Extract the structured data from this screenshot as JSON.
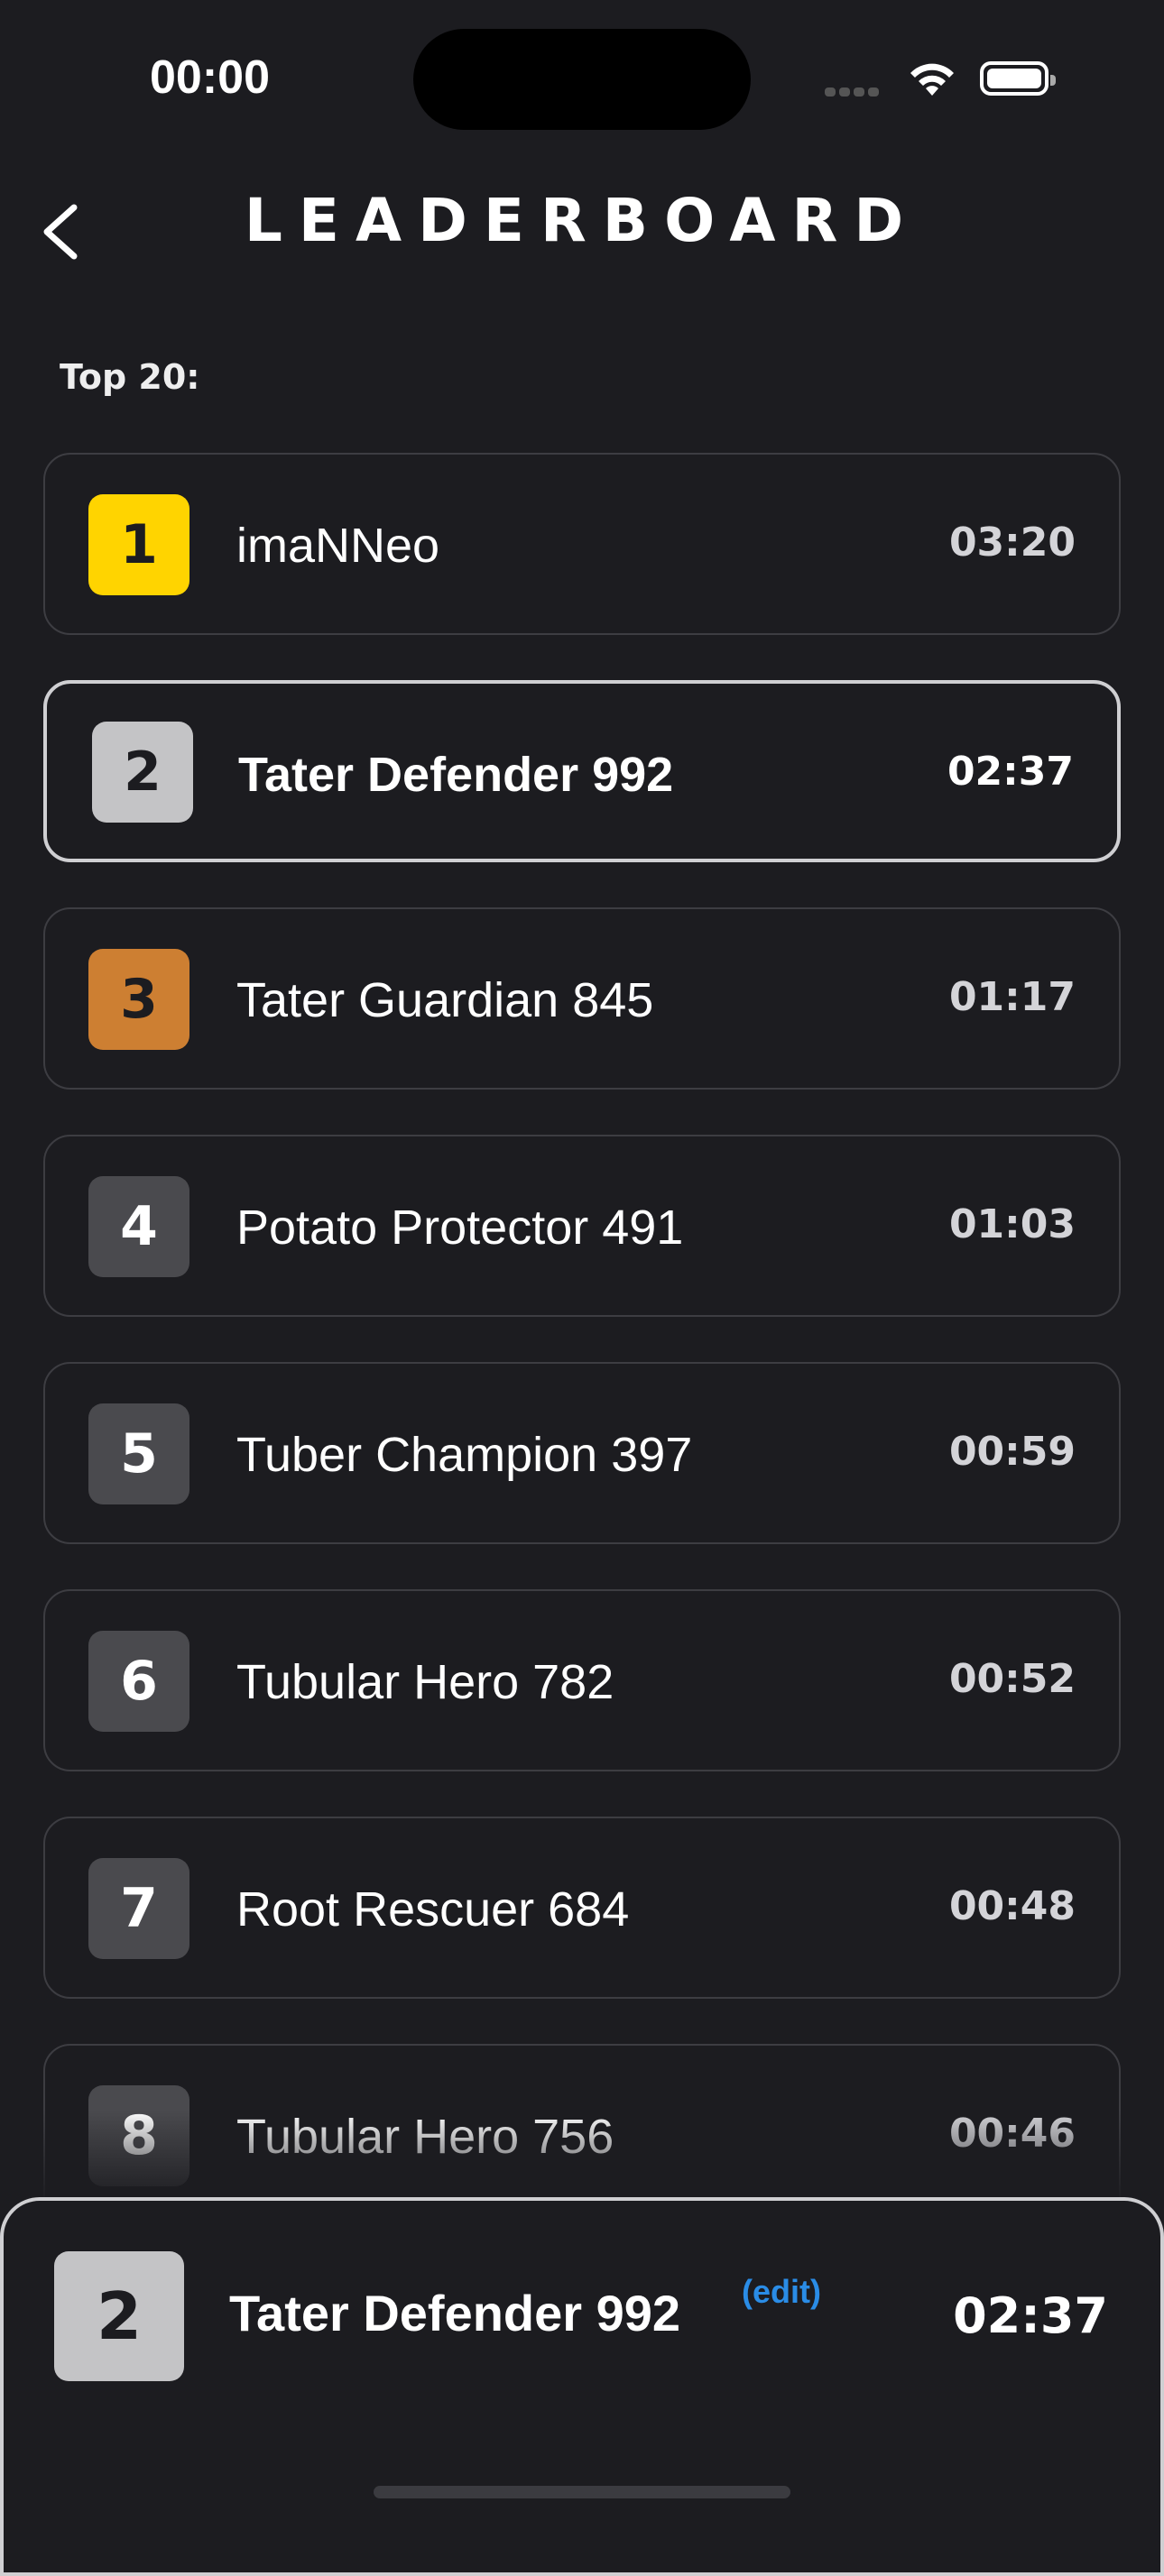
{
  "status_bar": {
    "time": "00:00"
  },
  "header": {
    "title": "LEADERBOARD",
    "back_icon": "chevron-left-icon"
  },
  "section_label": "Top 20:",
  "colors": {
    "background": "#1c1c20",
    "gold": "#ffd400",
    "silver": "#c4c4c6",
    "bronze": "#cd7f32",
    "default_rank": "#4a4a4e",
    "edit_link": "#2a8ce6"
  },
  "leaderboard": [
    {
      "rank": "1",
      "name": "imaNNeo",
      "score": "03:20",
      "badge": "gold",
      "highlighted": false
    },
    {
      "rank": "2",
      "name": "Tater Defender 992",
      "score": "02:37",
      "badge": "silver",
      "highlighted": true
    },
    {
      "rank": "3",
      "name": "Tater Guardian 845",
      "score": "01:17",
      "badge": "bronze",
      "highlighted": false
    },
    {
      "rank": "4",
      "name": "Potato Protector 491",
      "score": "01:03",
      "badge": "default",
      "highlighted": false
    },
    {
      "rank": "5",
      "name": "Tuber Champion 397",
      "score": "00:59",
      "badge": "default",
      "highlighted": false
    },
    {
      "rank": "6",
      "name": "Tubular Hero 782",
      "score": "00:52",
      "badge": "default",
      "highlighted": false
    },
    {
      "rank": "7",
      "name": "Root Rescuer 684",
      "score": "00:48",
      "badge": "default",
      "highlighted": false
    },
    {
      "rank": "8",
      "name": "Tubular Hero 756",
      "score": "00:46",
      "badge": "default",
      "highlighted": false
    }
  ],
  "current_user": {
    "rank": "2",
    "name": "Tater Defender 992",
    "edit_label": "(edit)",
    "score": "02:37"
  }
}
